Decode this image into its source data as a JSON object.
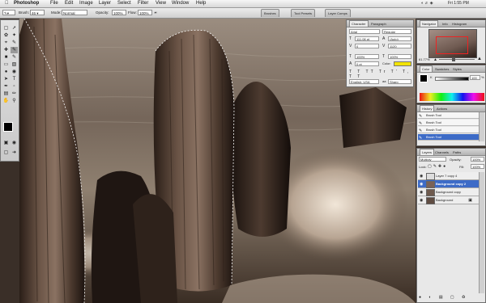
{
  "menubar": {
    "app": "Photoshop",
    "items": [
      "File",
      "Edit",
      "Image",
      "Layer",
      "Select",
      "Filter",
      "View",
      "Window",
      "Help"
    ],
    "clock": "Fri 1:55 PM"
  },
  "options": {
    "brush_label": "Brush:",
    "brush_size": "46",
    "mode_label": "Mode:",
    "mode_value": "Normal",
    "opacity_label": "Opacity:",
    "opacity_value": "100%",
    "flow_label": "Flow:",
    "flow_value": "100%",
    "well_tabs": [
      "Brushes",
      "Tool Presets",
      "Layer Comps"
    ]
  },
  "character": {
    "tabs": [
      "Character",
      "Paragraph"
    ],
    "font": "Arial",
    "style": "Regular",
    "size": "111.08 pt",
    "leading": "(Auto)",
    "kerning": "0",
    "tracking": "1120",
    "vscale": "100%",
    "hscale": "100%",
    "baseline": "0 pt",
    "color_label": "Color:",
    "language": "English: USA",
    "aa": "Sharp"
  },
  "navigator": {
    "tabs": [
      "Navigator",
      "Info",
      "Histogram"
    ],
    "zoom": "61.77%"
  },
  "color": {
    "tabs": [
      "Color",
      "Swatches",
      "Styles"
    ],
    "channel": "K",
    "value": "100",
    "unit": "%"
  },
  "history": {
    "tabs": [
      "History",
      "Actions"
    ],
    "items": [
      "Brush Tool",
      "Brush Tool",
      "Brush Tool",
      "Brush Tool"
    ]
  },
  "layers": {
    "tabs": [
      "Layers",
      "Channels",
      "Paths"
    ],
    "blend": "Multiply",
    "opacity_label": "Opacity:",
    "opacity": "100%",
    "lock_label": "Lock:",
    "fill_label": "Fill:",
    "fill": "100%",
    "rows": [
      "Layer 7 copy 4",
      "Background copy 2",
      "Background copy",
      "Background"
    ]
  }
}
